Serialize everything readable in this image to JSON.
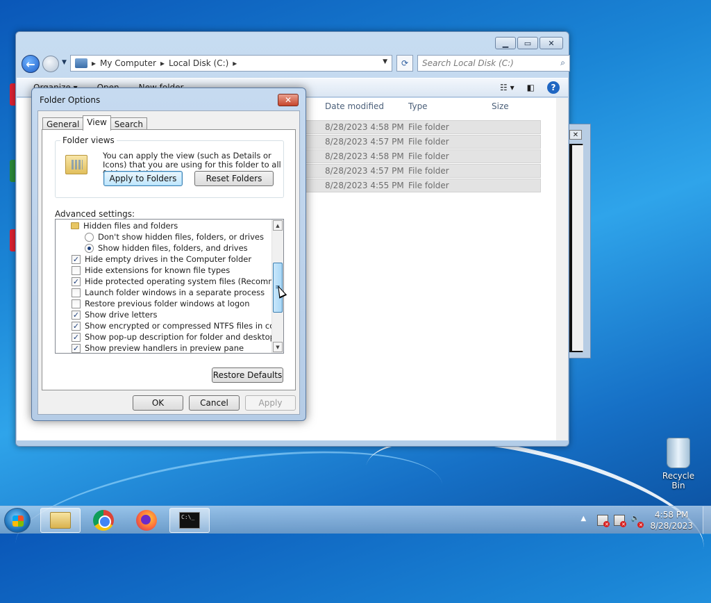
{
  "explorer": {
    "breadcrumb": [
      "My Computer",
      "Local Disk (C:)"
    ],
    "search_placeholder": "Search Local Disk (C:)",
    "toolbar": {
      "organize": "Organize ▾",
      "open": "Open",
      "new_folder": "New folder"
    },
    "columns": {
      "date": "Date modified",
      "type": "Type",
      "size": "Size"
    },
    "rows": [
      {
        "date": "8/28/2023 4:58 PM",
        "type": "File folder"
      },
      {
        "date": "8/28/2023 4:57 PM",
        "type": "File folder"
      },
      {
        "date": "8/28/2023 4:58 PM",
        "type": "File folder"
      },
      {
        "date": "8/28/2023 4:57 PM",
        "type": "File folder"
      },
      {
        "date": "8/28/2023 4:55 PM",
        "type": "File folder"
      }
    ]
  },
  "dialog": {
    "title": "Folder Options",
    "tabs": [
      "General",
      "View",
      "Search"
    ],
    "active_tab": "View",
    "folder_views": {
      "label": "Folder views",
      "text": "You can apply the view (such as Details or Icons) that you are using for this folder to all folders of this type.",
      "apply_button": "Apply to Folders",
      "reset_button": "Reset Folders"
    },
    "advanced_label": "Advanced settings:",
    "settings": [
      {
        "kind": "folder",
        "label": "Hidden files and folders"
      },
      {
        "kind": "radio",
        "label": "Don't show hidden files, folders, or drives",
        "checked": false
      },
      {
        "kind": "radio",
        "label": "Show hidden files, folders, and drives",
        "checked": true
      },
      {
        "kind": "check",
        "label": "Hide empty drives in the Computer folder",
        "checked": true
      },
      {
        "kind": "check",
        "label": "Hide extensions for known file types",
        "checked": false
      },
      {
        "kind": "check",
        "label": "Hide protected operating system files (Recommended)",
        "checked": true
      },
      {
        "kind": "check",
        "label": "Launch folder windows in a separate process",
        "checked": false
      },
      {
        "kind": "check",
        "label": "Restore previous folder windows at logon",
        "checked": false
      },
      {
        "kind": "check",
        "label": "Show drive letters",
        "checked": true
      },
      {
        "kind": "check",
        "label": "Show encrypted or compressed NTFS files in color",
        "checked": true
      },
      {
        "kind": "check",
        "label": "Show pop-up description for folder and desktop items",
        "checked": true
      },
      {
        "kind": "check",
        "label": "Show preview handlers in preview pane",
        "checked": true
      }
    ],
    "restore_defaults": "Restore Defaults",
    "ok": "OK",
    "cancel": "Cancel",
    "apply": "Apply"
  },
  "desktop": {
    "recycle_bin": "Recycle Bin"
  },
  "taskbar": {
    "time": "4:58 PM",
    "date": "8/28/2023"
  },
  "colors": {
    "selection": "#3c7fb1",
    "desktop": "#1b86d6"
  }
}
